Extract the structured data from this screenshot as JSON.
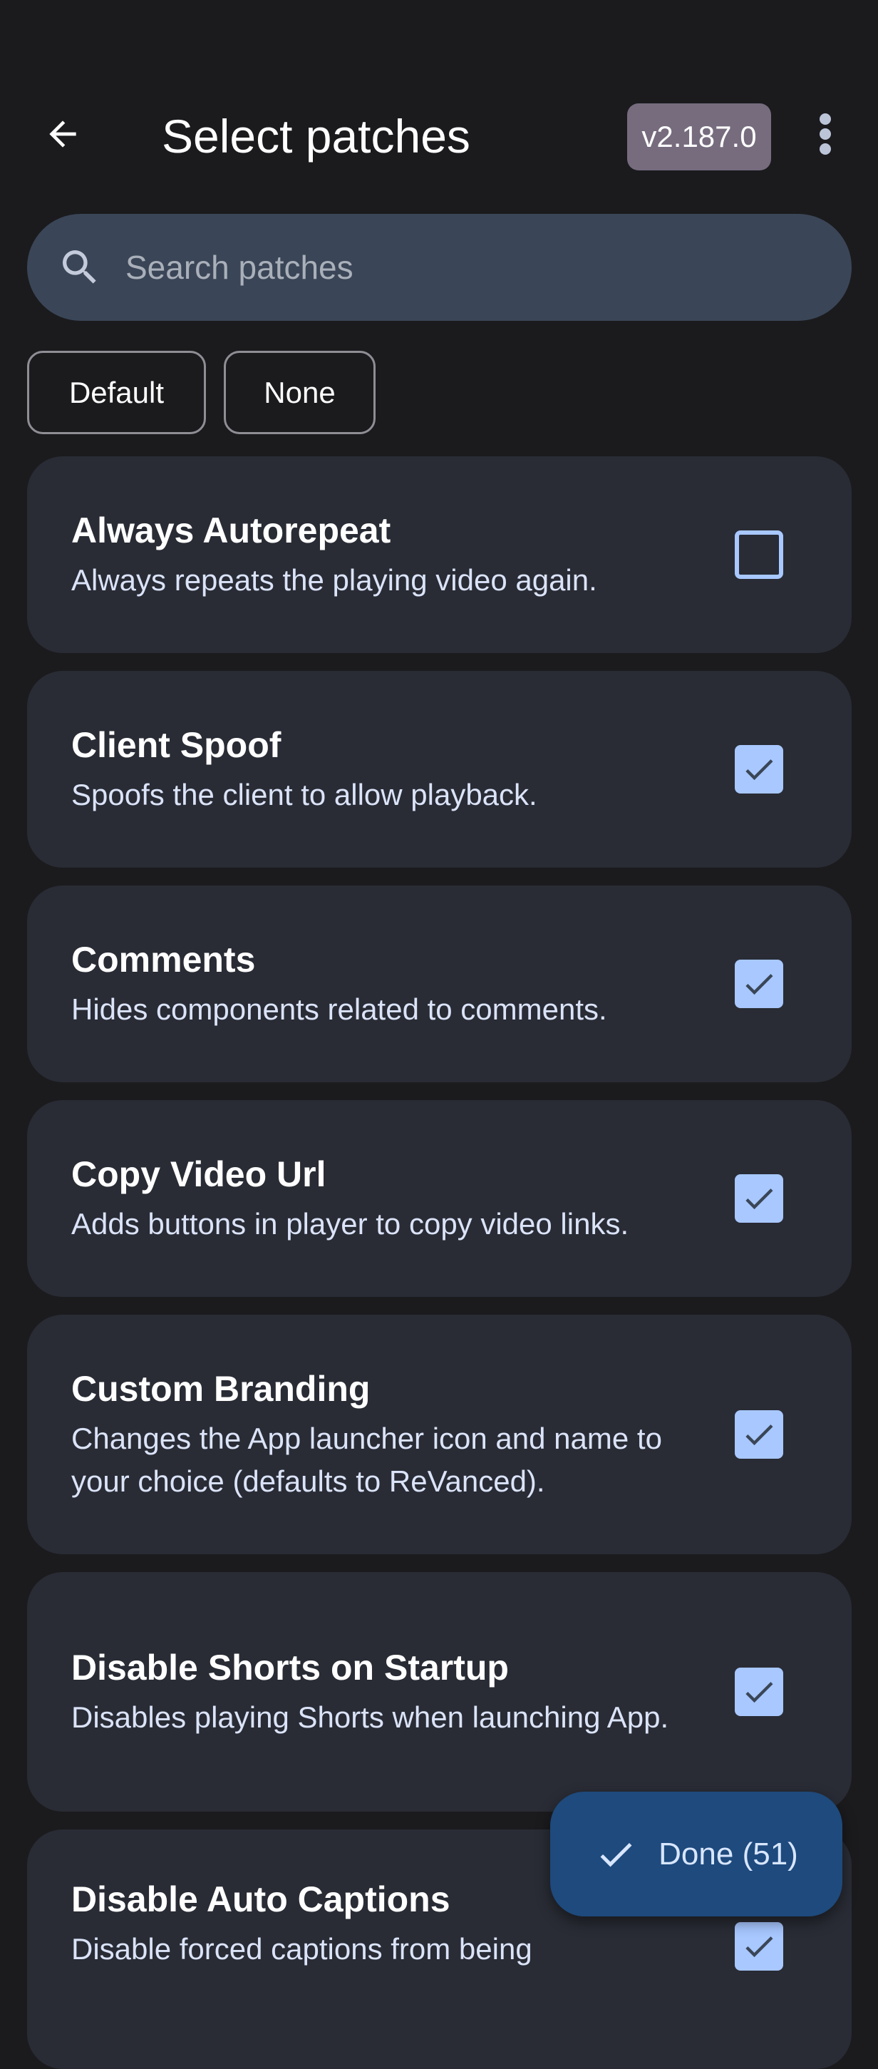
{
  "header": {
    "back_icon": "arrow-back-icon",
    "title": "Select patches",
    "version": "v2.187.0",
    "menu_icon": "more-vert-icon"
  },
  "search": {
    "icon": "search-icon",
    "placeholder": "Search patches",
    "value": ""
  },
  "filters": {
    "default_label": "Default",
    "none_label": "None"
  },
  "patches": [
    {
      "name": "Always Autorepeat",
      "description": "Always repeats the playing video again.",
      "selected": false
    },
    {
      "name": "Client Spoof",
      "description": "Spoofs the client to allow playback.",
      "selected": true
    },
    {
      "name": "Comments",
      "description": "Hides components related to comments.",
      "selected": true
    },
    {
      "name": "Copy Video Url",
      "description": "Adds buttons in player to copy video links.",
      "selected": true
    },
    {
      "name": "Custom Branding",
      "description": "Changes the App launcher icon and name to your choice (defaults to ReVanced).",
      "selected": true
    },
    {
      "name": "Disable Shorts on Startup",
      "description": "Disables playing Shorts when launching App.",
      "selected": true
    },
    {
      "name": "Disable Auto Captions",
      "description": "Disable forced captions from being",
      "selected": true
    }
  ],
  "done_button": {
    "icon": "check-icon",
    "label": "Done (51)"
  },
  "colors": {
    "background": "#1b1b1e",
    "card": "#292c35",
    "accent": "#a8c8ff",
    "fab": "#1e4a7d",
    "version_chip": "#766c7e",
    "search_bg": "#3a4657"
  }
}
